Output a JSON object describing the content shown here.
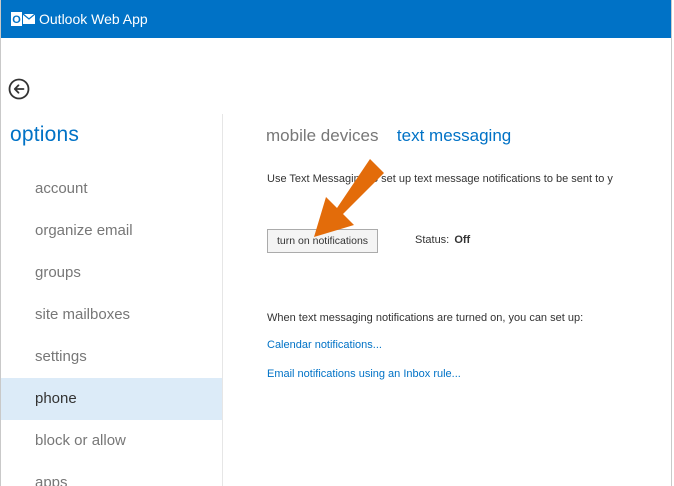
{
  "app": {
    "title": "Outlook Web App",
    "logo_letters": "O"
  },
  "colors": {
    "accent": "#0072c6",
    "selected_bg": "#dcebf8",
    "arrow": "#e36c0a"
  },
  "back_button": {
    "icon": "back-arrow-circle-icon"
  },
  "sidebar": {
    "title": "options",
    "selected": "phone",
    "items": [
      {
        "label": "account"
      },
      {
        "label": "organize email"
      },
      {
        "label": "groups"
      },
      {
        "label": "site mailboxes"
      },
      {
        "label": "settings"
      },
      {
        "label": "phone"
      },
      {
        "label": "block or allow"
      },
      {
        "label": "apps"
      }
    ]
  },
  "main": {
    "tabs": [
      {
        "label": "mobile devices",
        "active": false
      },
      {
        "label": "text messaging",
        "active": true
      }
    ],
    "description": "Use Text Messaging to set up text message notifications to be sent to y",
    "notifications_button": "turn on notifications",
    "status": {
      "label": "Status:",
      "value": "Off"
    },
    "setup_text": "When text messaging notifications are turned on, you can set up:",
    "links": [
      {
        "label": "Calendar notifications..."
      },
      {
        "label": "Email notifications using an Inbox rule..."
      }
    ]
  },
  "annotation": {
    "icon": "orange-arrow-annotation"
  }
}
